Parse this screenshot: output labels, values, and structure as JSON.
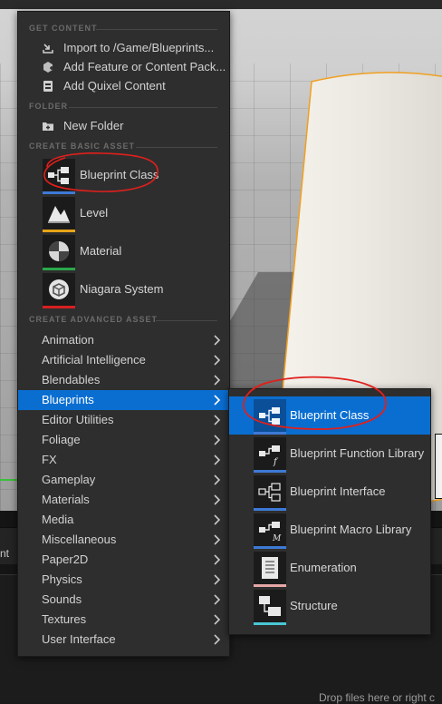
{
  "context_menu": {
    "sections": {
      "get_content": "GET CONTENT",
      "folder": "FOLDER",
      "create_basic_asset": "CREATE BASIC ASSET",
      "create_advanced_asset": "CREATE ADVANCED ASSET"
    },
    "get_content_items": [
      {
        "label": "Import to /Game/Blueprints...",
        "icon": "import-icon"
      },
      {
        "label": "Add Feature or Content Pack...",
        "icon": "content-pack-icon"
      },
      {
        "label": "Add Quixel Content",
        "icon": "quixel-icon"
      }
    ],
    "folder_items": [
      {
        "label": "New Folder",
        "icon": "new-folder-icon"
      }
    ],
    "basic_assets": [
      {
        "label": "Blueprint Class",
        "icon": "blueprint-class-icon",
        "color": "#3d7ad6"
      },
      {
        "label": "Level",
        "icon": "level-icon",
        "color": "#e8a317"
      },
      {
        "label": "Material",
        "icon": "material-icon",
        "color": "#2aa84a"
      },
      {
        "label": "Niagara System",
        "icon": "niagara-icon",
        "color": "#d62020"
      }
    ],
    "advanced_categories": [
      "Animation",
      "Artificial Intelligence",
      "Blendables",
      "Blueprints",
      "Editor Utilities",
      "Foliage",
      "FX",
      "Gameplay",
      "Materials",
      "Media",
      "Miscellaneous",
      "Paper2D",
      "Physics",
      "Sounds",
      "Textures",
      "User Interface"
    ],
    "active_category": "Blueprints"
  },
  "blueprints_submenu": {
    "items": [
      {
        "label": "Blueprint Class",
        "icon": "blueprint-class-icon",
        "color": "#3d7ad6"
      },
      {
        "label": "Blueprint Function Library",
        "icon": "blueprint-function-library-icon",
        "color": "#3d7ad6"
      },
      {
        "label": "Blueprint Interface",
        "icon": "blueprint-interface-icon",
        "color": "#3d7ad6"
      },
      {
        "label": "Blueprint Macro Library",
        "icon": "blueprint-macro-library-icon",
        "color": "#3d7ad6"
      },
      {
        "label": "Enumeration",
        "icon": "enumeration-icon",
        "color": "#e6a7a7"
      },
      {
        "label": "Structure",
        "icon": "structure-icon",
        "color": "#49c6d4"
      }
    ],
    "active_item": "Blueprint Class"
  },
  "background": {
    "panel_tab_fragment": "nt",
    "drop_hint": "Drop files here or right c"
  },
  "colors": {
    "accent": "#0a6ed1",
    "annotation": "#e0201c",
    "selection_outline": "#f0a020"
  }
}
